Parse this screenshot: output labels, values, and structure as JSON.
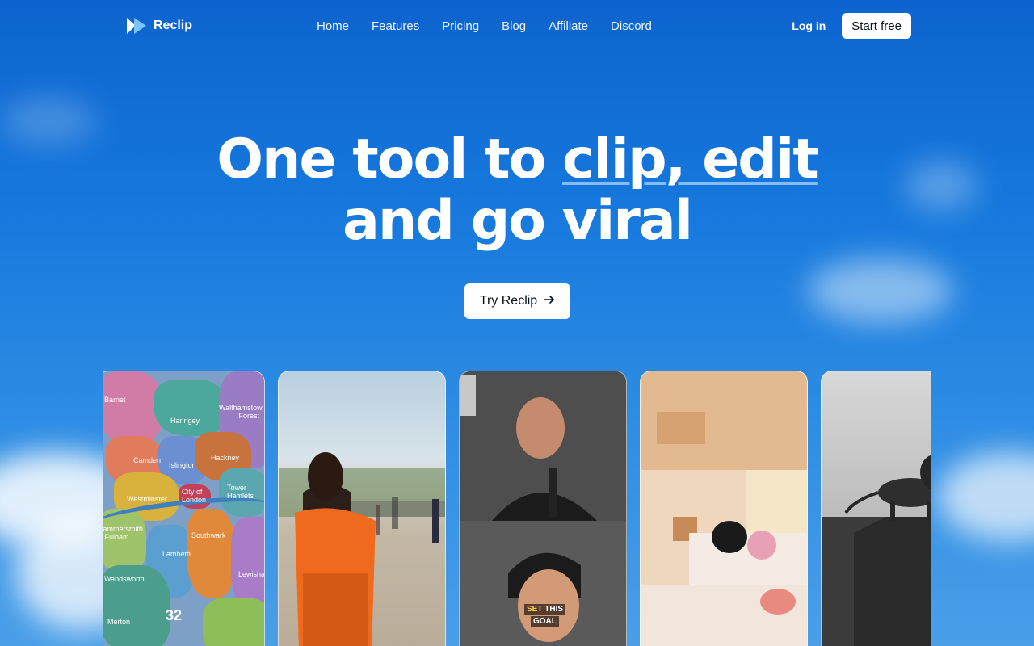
{
  "nav": {
    "brand": "Reclip",
    "links": [
      "Home",
      "Features",
      "Pricing",
      "Blog",
      "Affiliate",
      "Discord"
    ],
    "login": "Log in",
    "start_free": "Start free"
  },
  "hero": {
    "line1_plain": "One tool to ",
    "line1_underlined": "clip, edit",
    "line2": "and go viral",
    "cta": "Try Reclip"
  },
  "cards": {
    "map_labels": [
      "Barnet",
      "Haringey",
      "Walthamstow Forest",
      "Camden",
      "Islington",
      "Hackney",
      "Westminster",
      "City of London",
      "Tower Hamlets",
      "Hammersmith & Fulham",
      "Southwark",
      "Lambeth",
      "Lewisham",
      "Wandsworth",
      "Merton"
    ],
    "map_number": "32",
    "caption_a": "SET",
    "caption_b": "THIS",
    "caption_c": "GOAL"
  }
}
